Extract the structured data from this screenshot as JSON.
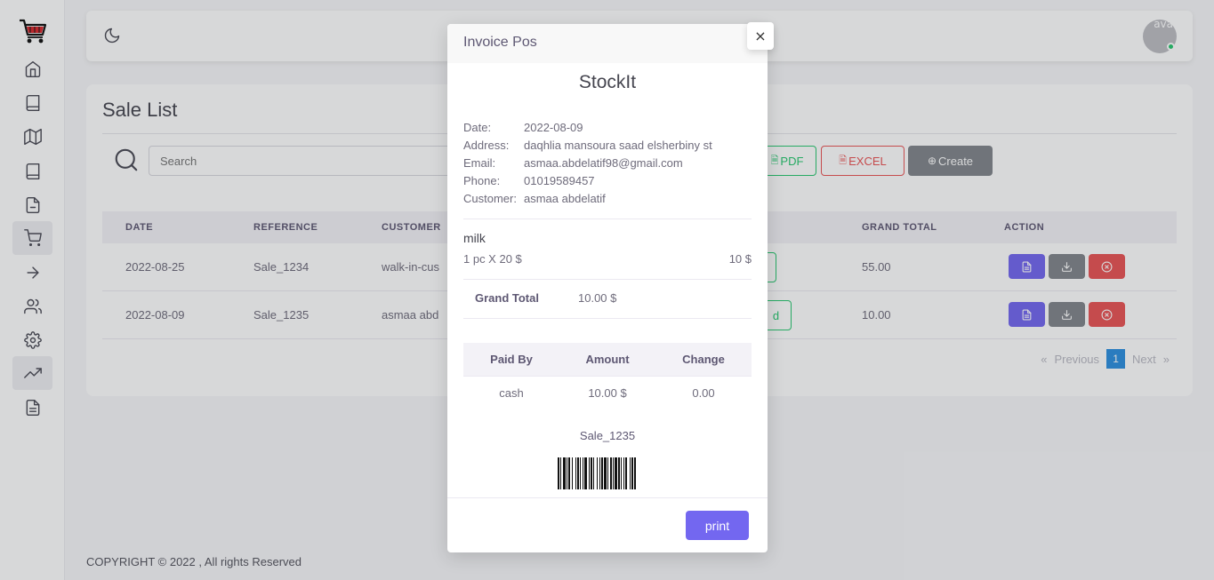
{
  "page": {
    "title": "Sale List",
    "search_placeholder": "Search",
    "buttons": {
      "pdf": "PDF",
      "excel": "EXCEL",
      "create": "Create"
    },
    "footer": "COPYRIGHT © 2022 , All rights Reserved",
    "avatar_alt": "ava"
  },
  "table": {
    "headers": [
      "DATE",
      "REFERENCE",
      "CUSTOMER",
      "GRAND TOTAL",
      "ACTION"
    ],
    "rows": [
      {
        "date": "2022-08-25",
        "reference": "Sale_1234",
        "customer": "walk-in-cus",
        "status": "",
        "grand_total": "55.00"
      },
      {
        "date": "2022-08-09",
        "reference": "Sale_1235",
        "customer": "asmaa abd",
        "status": "d",
        "grand_total": "10.00"
      }
    ]
  },
  "pagination": {
    "prev_arrow": "«",
    "previous": "Previous",
    "current": "1",
    "next": "Next",
    "next_arrow": "»"
  },
  "modal": {
    "title": "Invoice Pos",
    "close": "×",
    "store": "StockIt",
    "info": [
      {
        "label": "Date:",
        "value": "2022-08-09"
      },
      {
        "label": "Address:",
        "value": "daqhlia mansoura saad elsherbiny st"
      },
      {
        "label": "Email:",
        "value": "asmaa.abdelatif98@gmail.com"
      },
      {
        "label": "Phone:",
        "value": "01019589457"
      },
      {
        "label": "Customer:",
        "value": "asmaa abdelatif"
      }
    ],
    "item": {
      "name": "milk",
      "qty": "1 pc X 20 $",
      "total": "10 $"
    },
    "grand_total_label": "Grand Total",
    "grand_total_value": "10.00 $",
    "payment": {
      "headers": [
        "Paid By",
        "Amount",
        "Change"
      ],
      "row": [
        "cash",
        "10.00 $",
        "0.00"
      ]
    },
    "reference": "Sale_1235",
    "print": "print"
  },
  "colors": {
    "primary": "#7367f0",
    "success": "#28c76f",
    "danger": "#ea5455",
    "secondary": "#82868b"
  }
}
